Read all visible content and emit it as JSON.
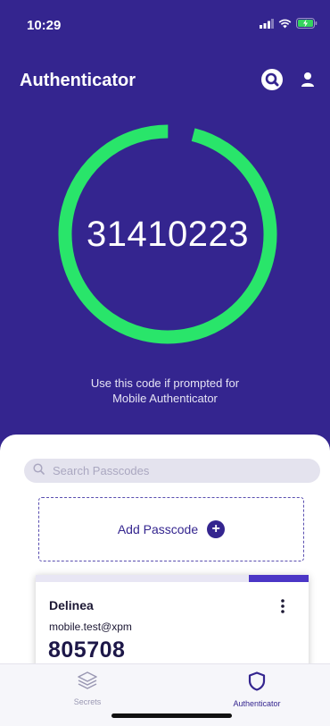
{
  "status_bar": {
    "time": "10:29"
  },
  "header": {
    "title": "Authenticator"
  },
  "authenticator": {
    "code": "31410223",
    "remaining_fraction": 0.96,
    "hint_line1": "Use this code if prompted for",
    "hint_line2": "Mobile Authenticator"
  },
  "search": {
    "placeholder": "Search Passcodes"
  },
  "add_passcode": {
    "label": "Add Passcode"
  },
  "passcodes": [
    {
      "name": "Delinea",
      "account": "mobile.test@xpm",
      "code": "805708",
      "remaining_fraction": 0.22
    }
  ],
  "tabs": [
    {
      "label": "Secrets",
      "active": false
    },
    {
      "label": "Authenticator",
      "active": true
    }
  ],
  "colors": {
    "primary": "#34258f",
    "ring": "#29e56a",
    "card_progress": "#4b36c6"
  }
}
